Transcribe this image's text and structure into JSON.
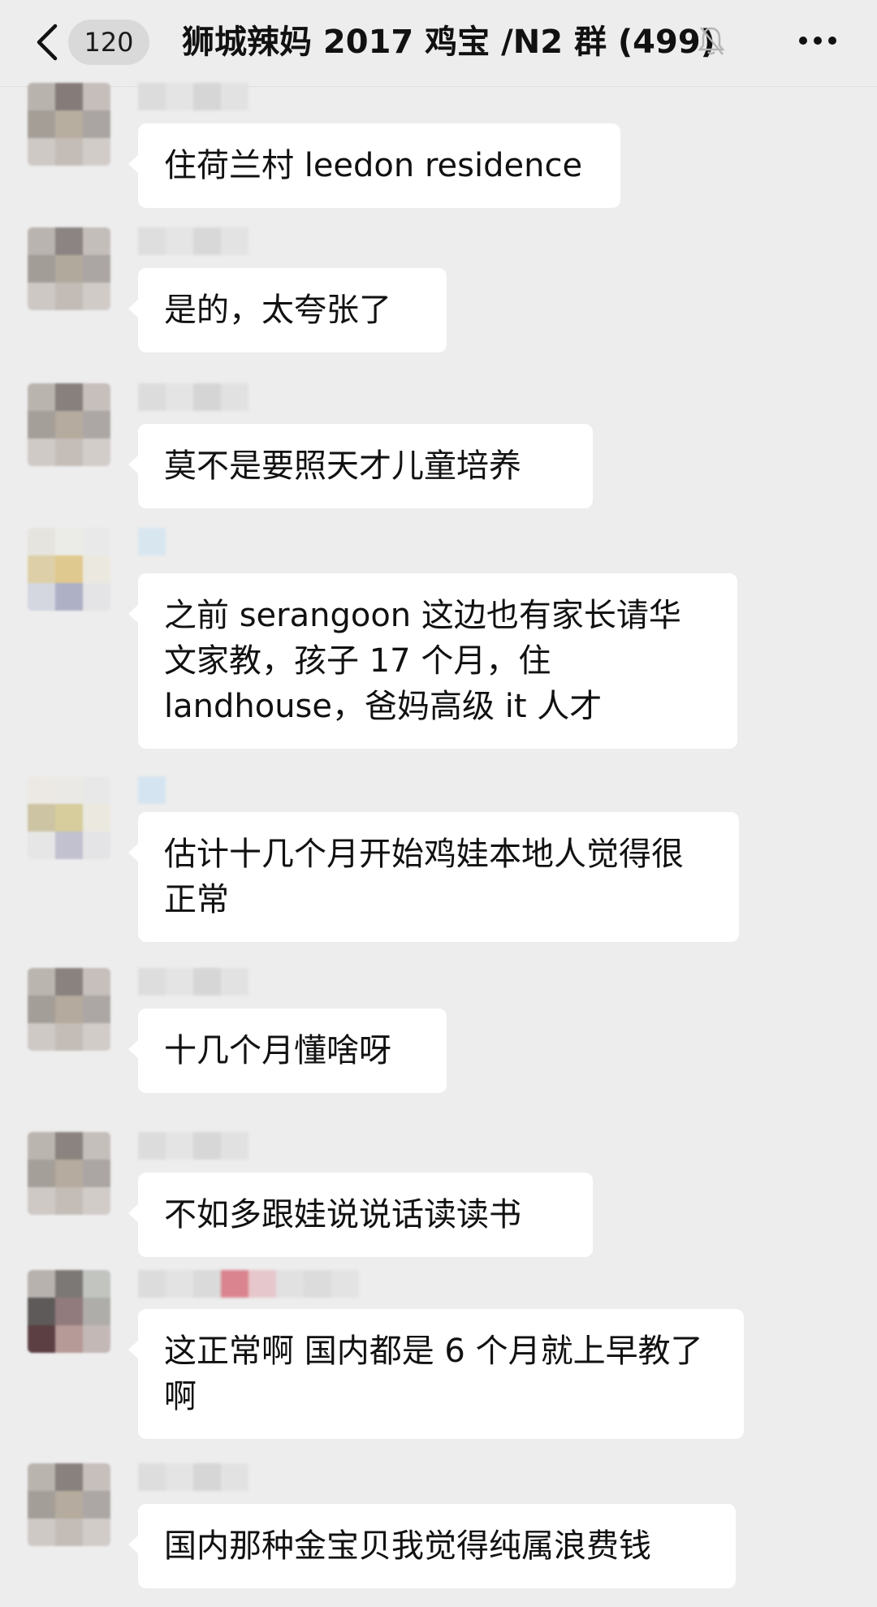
{
  "header": {
    "back_icon": "chevron-left-icon",
    "unread_count": "120",
    "title": "狮城辣妈 2017 鸡宝 /N2 群 (499)",
    "mute_icon": "bell-off-icon",
    "more_icon": "more-icon"
  },
  "messages": [
    {
      "text": "住荷兰村 leedon residence"
    },
    {
      "text": "是的，太夸张了"
    },
    {
      "text": "莫不是要照天才儿童培养"
    },
    {
      "text": "之前 serangoon 这边也有家长请华文家教，孩子 17 个月，住 landhouse，爸妈高级 it 人才"
    },
    {
      "text": "估计十几个月开始鸡娃本地人觉得很正常"
    },
    {
      "text": "十几个月懂啥呀"
    },
    {
      "text": "不如多跟娃说说话读读书"
    },
    {
      "text": "这正常啊 国内都是 6 个月就上早教了啊"
    },
    {
      "text": "国内那种金宝贝我觉得纯属浪费钱"
    }
  ],
  "colors": {
    "background": "#ededed",
    "bubble": "#ffffff",
    "text": "#111111",
    "badge": "#d9d9d9"
  }
}
